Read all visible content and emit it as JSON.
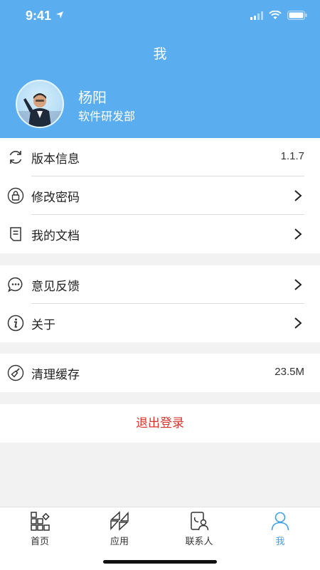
{
  "status_bar": {
    "time": "9:41"
  },
  "header": {
    "title": "我"
  },
  "profile": {
    "name": "杨阳",
    "department": "软件研发部"
  },
  "menu_groups": [
    [
      {
        "label": "版本信息",
        "value": "1.1.7",
        "icon": "refresh-icon"
      },
      {
        "label": "修改密码",
        "icon": "lock-icon"
      },
      {
        "label": "我的文档",
        "icon": "document-icon"
      }
    ],
    [
      {
        "label": "意见反馈",
        "icon": "chat-bubble-icon"
      },
      {
        "label": "关于",
        "icon": "info-icon"
      }
    ],
    [
      {
        "label": "清理缓存",
        "value": "23.5M",
        "icon": "broom-icon"
      }
    ]
  ],
  "logout_label": "退出登录",
  "tabs": [
    {
      "label": "首页",
      "icon": "grid-home-icon",
      "active": false
    },
    {
      "label": "应用",
      "icon": "apps-icon",
      "active": false
    },
    {
      "label": "联系人",
      "icon": "contacts-icon",
      "active": false
    },
    {
      "label": "我",
      "icon": "person-icon",
      "active": true
    }
  ],
  "colors": {
    "header": "#5aaef0",
    "logout": "#d9342b",
    "tab_active": "#3ea0e8"
  }
}
